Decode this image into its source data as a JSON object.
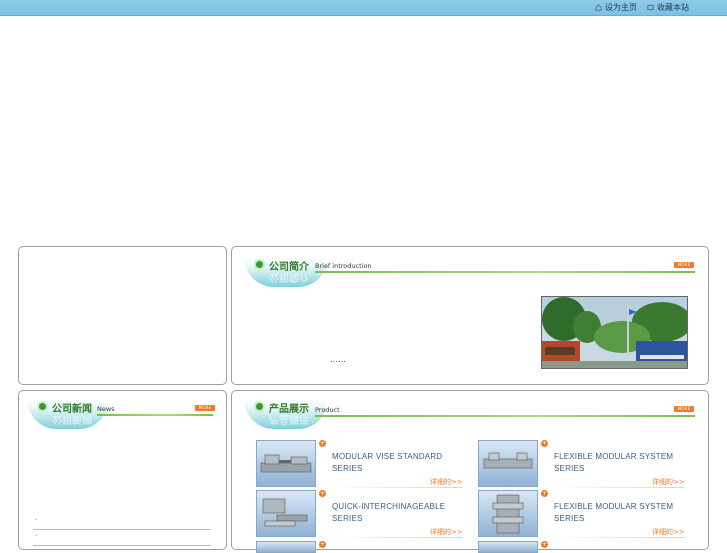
{
  "header": {
    "set_home_label": "设为主页",
    "bookmark_label": "收藏本站",
    "home_icon": "home-icon",
    "bookmark_icon": "bookmark-icon"
  },
  "brief": {
    "title_cn": "公司简介",
    "title_en": "Brief introduction",
    "more_label": "MORE",
    "excerpt": "……"
  },
  "news": {
    "title_cn": "公司新闻",
    "title_en": "News",
    "more_label": "MORE",
    "items": [
      "·",
      "·"
    ]
  },
  "products": {
    "title_cn": "产品展示",
    "title_en": "Product",
    "more_label": "MORE",
    "detail_label": "详细的>>",
    "items": [
      {
        "name": "MODULAR VISE STANDARD SERIES",
        "icon": "plus-icon"
      },
      {
        "name": "FLEXIBLE MODULAR SYSTEM SERIES",
        "icon": "plus-icon"
      },
      {
        "name": "QUICK-INTERCHINAGEABLE SERIES",
        "icon": "plus-icon"
      },
      {
        "name": "FLEXIBLE MODULAR SYSTEM SERIES",
        "icon": "plus-icon"
      }
    ]
  },
  "colors": {
    "accent_green": "#3b9a2f",
    "accent_orange": "#f07a2a",
    "topbar_blue": "#8fcbe8",
    "product_text": "#3c5e86"
  }
}
